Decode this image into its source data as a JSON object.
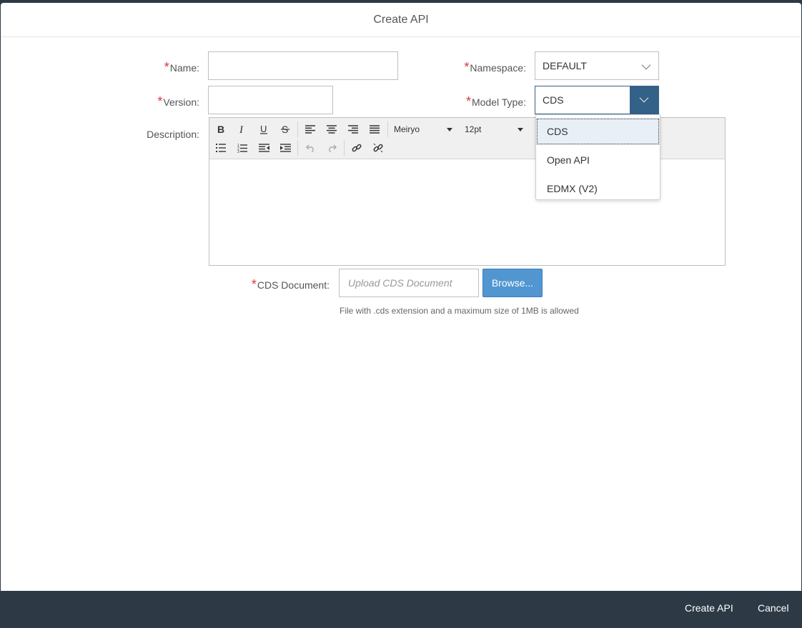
{
  "dialog": {
    "title": "Create API"
  },
  "form": {
    "required_marker": "*",
    "name": {
      "label": "Name:",
      "value": ""
    },
    "version": {
      "label": "Version:",
      "value": ""
    },
    "namespace": {
      "label": "Namespace:",
      "value": "DEFAULT"
    },
    "model_type": {
      "label": "Model Type:",
      "value": "CDS",
      "options": [
        "CDS",
        "Open API",
        "EDMX (V2)"
      ],
      "selected_index": 0
    },
    "description": {
      "label": "Description:",
      "font_family": "Meiryo",
      "font_size": "12pt"
    },
    "cds_document": {
      "label": "CDS Document:",
      "placeholder": "Upload CDS Document",
      "browse_label": "Browse...",
      "hint": "File with .cds extension and a maximum size of 1MB is allowed"
    }
  },
  "footer": {
    "create_label": "Create API",
    "cancel_label": "Cancel"
  },
  "colors": {
    "accent": "#346187",
    "browse": "#5296d1",
    "footer_bg": "#2d3a45",
    "required": "#d9363e"
  }
}
